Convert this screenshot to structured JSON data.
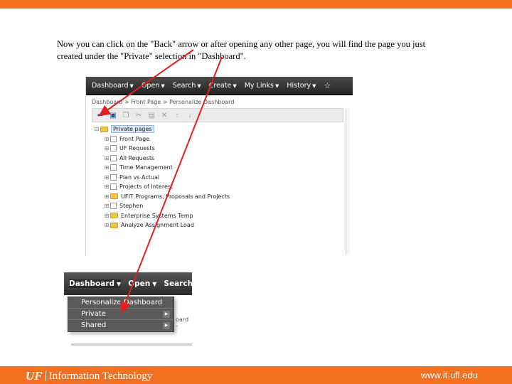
{
  "caption": "Now you can click on the \"Back\" arrow or after opening any other page, you will find the page you just created under the \"Private\" selection in \"Dashboard\".",
  "screenshot1": {
    "nav_items": [
      "Dashboard",
      "Open",
      "Search",
      "Create",
      "My Links",
      "History"
    ],
    "breadcrumb": "Dashboard > Front Page > Personalize Dashboard",
    "toolbar_icons": [
      "back-arrow-icon",
      "save-as-icon",
      "copy-icon",
      "cut-icon",
      "paste-icon",
      "delete-icon",
      "move-up-icon",
      "move-down-icon"
    ],
    "tree_root": "Private pages",
    "tree_items": [
      {
        "label": "Front Page",
        "icon": "page"
      },
      {
        "label": "UF Requests",
        "icon": "page"
      },
      {
        "label": "All Requests",
        "icon": "page"
      },
      {
        "label": "Time Management",
        "icon": "page"
      },
      {
        "label": "Plan vs Actual",
        "icon": "page"
      },
      {
        "label": "Projects of Interest",
        "icon": "page"
      },
      {
        "label": "UFIT Programs, Proposals and Projects",
        "icon": "folder"
      },
      {
        "label": "Stephen",
        "icon": "page"
      },
      {
        "label": "Enterprise Systems Temp",
        "icon": "folder"
      },
      {
        "label": "Analyze Assignment Load",
        "icon": "folder"
      }
    ]
  },
  "screenshot2": {
    "nav_items": [
      "Dashboard",
      "Open",
      "Search"
    ],
    "menu_items": [
      {
        "label": "Personalize Dashboard",
        "submenu": false
      },
      {
        "label": "Private",
        "submenu": true
      },
      {
        "label": "Shared",
        "submenu": true
      }
    ],
    "behind_text": "oard -"
  },
  "footer": {
    "brand_short": "UF",
    "brand_long": "Information Technology",
    "url": "www.it.ufl.edu"
  },
  "colors": {
    "accent_orange": "#f37021",
    "arrow_red": "#e02020"
  }
}
